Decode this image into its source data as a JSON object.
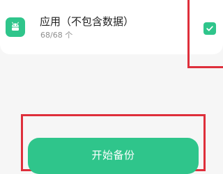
{
  "item": {
    "icon": "android-icon",
    "title": "应用（不包含数据）",
    "subtitle": "68/68 个",
    "checked": true
  },
  "action": {
    "start_backup_label": "开始备份"
  },
  "colors": {
    "accent": "#2fc58b",
    "highlight": "#de2f3b",
    "background": "#f6f6f6",
    "card": "#ffffff"
  }
}
